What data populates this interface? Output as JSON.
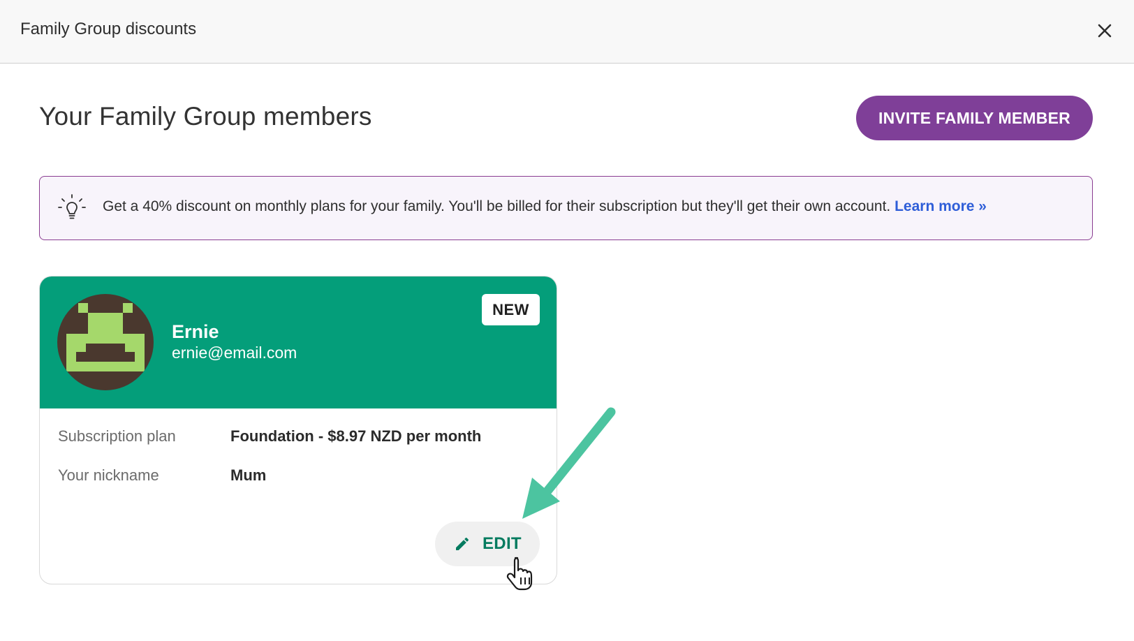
{
  "header": {
    "title": "Family Group discounts",
    "close_icon": "close-icon"
  },
  "main": {
    "title": "Your Family Group members",
    "invite_button": "INVITE FAMILY MEMBER"
  },
  "notice": {
    "icon": "lightbulb-icon",
    "text": "Get a 40% discount on monthly plans for your family. You'll be billed for their subscription but they'll get their own account. ",
    "link": "Learn more »"
  },
  "member_card": {
    "name": "Ernie",
    "email": "ernie@email.com",
    "badge": "NEW",
    "avatar_icon": "pixel-avatar-icon",
    "rows": [
      {
        "label": "Subscription plan",
        "value": "Foundation - $8.97 NZD per month"
      },
      {
        "label": "Your nickname",
        "value": "Mum"
      }
    ],
    "edit_button": "EDIT",
    "edit_icon": "pencil-icon"
  },
  "colors": {
    "brand_purple": "#7f3f98",
    "card_header_green": "#049e7a",
    "edit_green": "#047b5f",
    "link_blue": "#2f5ed8",
    "annotation_arrow": "#4cc4a0"
  }
}
